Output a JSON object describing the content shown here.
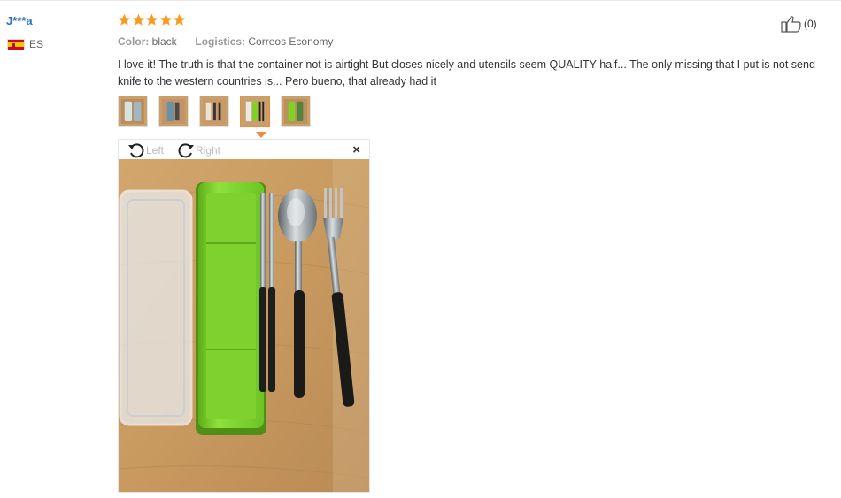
{
  "review": {
    "user": "J***a",
    "country": "ES",
    "rating": 5,
    "color_label": "Color:",
    "color_value": "black",
    "logistics_label": "Logistics:",
    "logistics_value": "Correos Economy",
    "text": "I love it! The truth is that the container not is airtight But closes nicely and utensils seem QUALITY half... The only missing that I put is not send knife to the western countries is... Pero bueno, that already had it",
    "like_count": "(0)"
  },
  "viewer": {
    "rotate_left": "Left",
    "rotate_right": "Right",
    "close": "×"
  },
  "colors": {
    "username": "#2a6fc9",
    "star": "#f79b1c",
    "active_thumb": "#f08a3c",
    "wood": "#c9a06a",
    "lid_green": "#7ed321"
  },
  "thumbnails": [
    "photo-1",
    "photo-2",
    "photo-3",
    "photo-4",
    "photo-5"
  ],
  "active_thumbnail": 4
}
